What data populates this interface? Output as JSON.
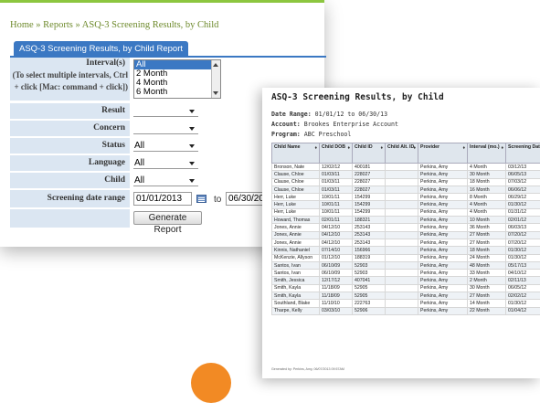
{
  "breadcrumb": {
    "home": "Home",
    "sep1": " » ",
    "reports": "Reports",
    "sep2": " » ",
    "current": "ASQ-3 Screening Results, by Child"
  },
  "tab": {
    "label": "ASQ-3 Screening Results, by Child Report"
  },
  "form": {
    "interval_label": "Interval(s)",
    "interval_help": "(To select multiple intervals, Ctrl + click [Mac: command + click])",
    "interval_options": [
      "All",
      "2 Month",
      "4 Month",
      "6 Month"
    ],
    "result_label": "Result",
    "result_value": "",
    "concern_label": "Concern",
    "concern_value": "",
    "status_label": "Status",
    "status_value": "All",
    "language_label": "Language",
    "language_value": "All",
    "child_label": "Child",
    "child_value": "All",
    "date_label": "Screening date range",
    "date_from": "01/01/2013",
    "date_to_label": "to",
    "date_to": "06/30/2013",
    "generate_label": "Generate Report"
  },
  "report": {
    "title": "ASQ-3 Screening Results, by Child",
    "date_range_label": "Date Range:",
    "date_range_value": "01/01/12 to 06/30/13",
    "account_label": "Account:",
    "account_value": "Brookes Enterprise Account",
    "program_label": "Program:",
    "program_value": "ABC Preschool",
    "columns": [
      "Child Name",
      "Child DOB",
      "Child ID",
      "Child Alt. ID",
      "Provider",
      "Interval (mo.)",
      "Screening Date"
    ],
    "rows": [
      [
        "Bronson, Nate",
        "12/02/12",
        "400181",
        "",
        "Perkins, Amy",
        "4 Month",
        "03/12/13"
      ],
      [
        "Clause, Chloe",
        "01/03/11",
        "228027",
        "",
        "Perkins, Amy",
        "30 Month",
        "06/05/13"
      ],
      [
        "Clause, Chloe",
        "01/03/11",
        "228027",
        "",
        "Perkins, Amy",
        "18 Month",
        "07/03/12"
      ],
      [
        "Clause, Chloe",
        "01/03/11",
        "228027",
        "",
        "Perkins, Amy",
        "16 Month",
        "06/06/12"
      ],
      [
        "Herr, Luke",
        "10/01/11",
        "154299",
        "",
        "Perkins, Amy",
        "8 Month",
        "06/29/12"
      ],
      [
        "Herr, Luke",
        "10/01/11",
        "154299",
        "",
        "Perkins, Amy",
        "4 Month",
        "01/30/12"
      ],
      [
        "Herr, Luke",
        "10/01/11",
        "154299",
        "",
        "Perkins, Amy",
        "4 Month",
        "01/31/12"
      ],
      [
        "Howard, Thomas",
        "02/01/11",
        "188321",
        "",
        "Perkins, Amy",
        "10 Month",
        "02/01/12"
      ],
      [
        "Jones, Annie",
        "04/12/10",
        "253143",
        "",
        "Perkins, Amy",
        "36 Month",
        "06/03/13"
      ],
      [
        "Jones, Annie",
        "04/12/10",
        "253143",
        "",
        "Perkins, Amy",
        "27 Month",
        "07/20/12"
      ],
      [
        "Jones, Annie",
        "04/12/10",
        "253143",
        "",
        "Perkins, Amy",
        "27 Month",
        "07/20/12"
      ],
      [
        "Kinnis, Nathaniel",
        "07/14/10",
        "156966",
        "",
        "Perkins, Amy",
        "18 Month",
        "01/30/12"
      ],
      [
        "McKenzie, Allyson",
        "01/12/10",
        "188319",
        "",
        "Perkins, Amy",
        "24 Month",
        "01/30/12"
      ],
      [
        "Santos, Ivan",
        "06/10/09",
        "52903",
        "",
        "Perkins, Amy",
        "48 Month",
        "05/17/13"
      ],
      [
        "Santos, Ivan",
        "06/10/09",
        "52903",
        "",
        "Perkins, Amy",
        "33 Month",
        "04/10/12"
      ],
      [
        "Smith, Jessica",
        "12/17/12",
        "407041",
        "",
        "Perkins, Amy",
        "2 Month",
        "02/11/13"
      ],
      [
        "Smith, Kayla",
        "11/18/09",
        "52905",
        "",
        "Perkins, Amy",
        "30 Month",
        "06/05/12"
      ],
      [
        "Smith, Kayla",
        "11/18/09",
        "52905",
        "",
        "Perkins, Amy",
        "27 Month",
        "02/02/12"
      ],
      [
        "Southland, Blake",
        "11/10/10",
        "222763",
        "",
        "Perkins, Amy",
        "14 Month",
        "01/30/12"
      ],
      [
        "Tharpe, Kelly",
        "03/03/10",
        "52906",
        "",
        "Perkins, Amy",
        "22 Month",
        "01/04/12"
      ]
    ],
    "footer": "Generated by: Perkins, Amy, 06/07/2013 09:57AM"
  },
  "colors": {
    "accent_blue": "#3b78c3",
    "header_green": "#8cc63f",
    "label_bg": "#dbe6f2",
    "orange": "#f28a24"
  }
}
